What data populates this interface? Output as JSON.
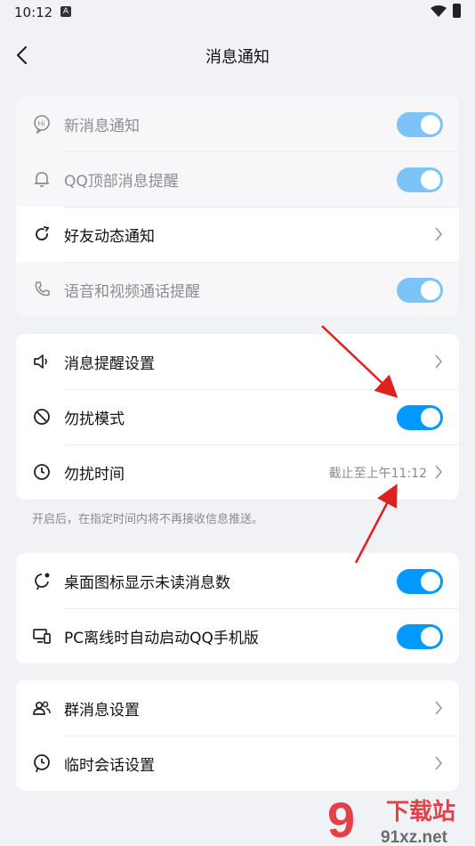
{
  "statusbar": {
    "time": "10:12",
    "notif_glyph": "A"
  },
  "header": {
    "title": "消息通知"
  },
  "group1": {
    "new_msg": "新消息通知",
    "qq_top": "QQ顶部消息提醒",
    "friend_updates": "好友动态通知",
    "voice_video": "语音和视频通话提醒"
  },
  "group2": {
    "reminder_settings": "消息提醒设置",
    "dnd_mode": "勿扰模式",
    "dnd_time": "勿扰时间",
    "dnd_time_value": "截止至上午11:12"
  },
  "note": "开启后，在指定时间内将不再接收信息推送。",
  "group3": {
    "badge_count": "桌面图标显示未读消息数",
    "pc_offline": "PC离线时自动启动QQ手机版"
  },
  "group4": {
    "group_msg": "群消息设置",
    "temp_session": "临时会话设置"
  },
  "toggles": {
    "new_msg": true,
    "qq_top": true,
    "voice_video": true,
    "dnd_mode": true,
    "badge_count": true,
    "pc_offline": true
  },
  "watermark": {
    "text": "91xz.net",
    "cn": "下载站",
    "glyph": "9"
  },
  "colors": {
    "accent": "#0099ff",
    "accent_disabled": "#7cc4f7",
    "arrow": "#e02020"
  }
}
